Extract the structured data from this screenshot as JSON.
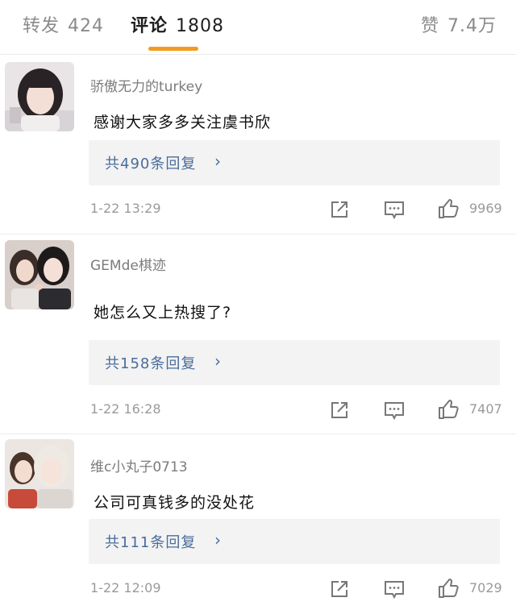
{
  "tabs": {
    "repost": {
      "label": "转发",
      "count": "424"
    },
    "comments": {
      "label": "评论",
      "count": "1808"
    },
    "likes": {
      "label": "赞",
      "count": "7.4万"
    }
  },
  "comments": [
    {
      "username": "骄傲无力的turkey",
      "text": "感谢大家多多关注虞书欣",
      "replies": "共490条回复",
      "time": "1-22  13:29",
      "likes": "9969"
    },
    {
      "username": "GEMde棋迹",
      "text": "她怎么又上热搜了?",
      "replies": "共158条回复",
      "time": "1-22  16:28",
      "likes": "7407"
    },
    {
      "username": "维c小丸子0713",
      "text": "公司可真钱多的没处花",
      "replies": "共111条回复",
      "time": "1-22  12:09",
      "likes": "7029"
    }
  ],
  "icons": {
    "reply_chevron": "chevron-right-icon",
    "share": "share-icon",
    "comment": "comment-icon",
    "like": "thumbs-up-icon"
  },
  "colors": {
    "accent": "#f29c1f",
    "link": "#4a6c9b",
    "muted": "#9a9a9a"
  }
}
